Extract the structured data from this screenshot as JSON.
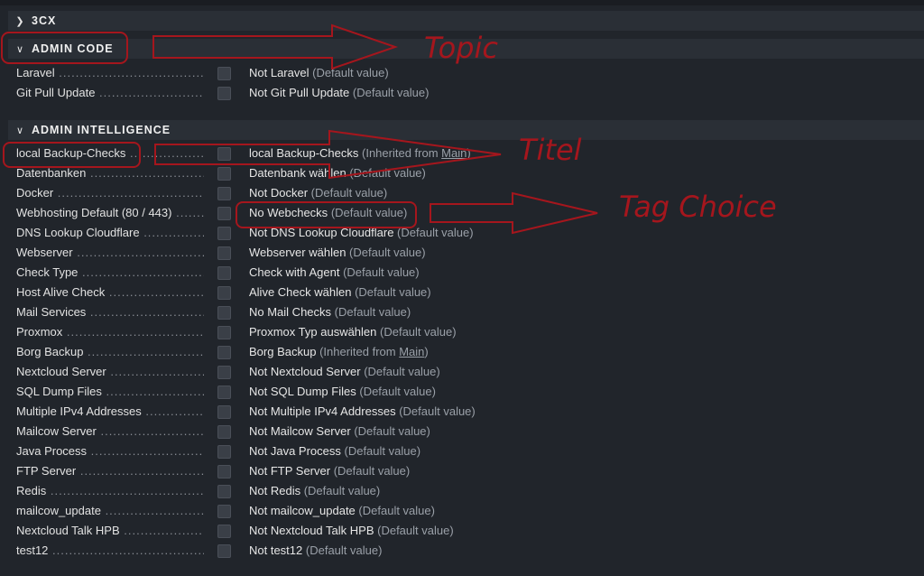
{
  "sections": {
    "cx": {
      "title": "3CX",
      "chevron": "chevron-right-icon"
    },
    "admin_code": {
      "title": "ADMIN CODE",
      "chevron": "chevron-down-icon",
      "rows": [
        {
          "label": "Laravel",
          "value": "Not Laravel",
          "note": "(Default value)"
        },
        {
          "label": "Git Pull Update",
          "value": "Not Git Pull Update",
          "note": "(Default value)"
        }
      ]
    },
    "admin_intelligence": {
      "title": "ADMIN INTELLIGENCE",
      "chevron": "chevron-down-icon",
      "rows": [
        {
          "label": "local Backup-Checks",
          "value": "local Backup-Checks",
          "note": "(Inherited from ",
          "link": "Main",
          "note_end": ")"
        },
        {
          "label": "Datenbanken",
          "value": "Datenbank wählen",
          "note": "(Default value)"
        },
        {
          "label": "Docker",
          "value": "Not Docker",
          "note": "(Default value)"
        },
        {
          "label": "Webhosting Default (80 / 443)",
          "value": "No Webchecks",
          "note": "(Default value)"
        },
        {
          "label": "DNS Lookup Cloudflare",
          "value": "Not DNS Lookup Cloudflare",
          "note": "(Default value)"
        },
        {
          "label": "Webserver",
          "value": "Webserver wählen",
          "note": "(Default value)"
        },
        {
          "label": "Check Type",
          "value": "Check with Agent",
          "note": "(Default value)"
        },
        {
          "label": "Host Alive Check",
          "value": "Alive Check wählen",
          "note": "(Default value)"
        },
        {
          "label": "Mail Services",
          "value": "No Mail Checks",
          "note": "(Default value)"
        },
        {
          "label": "Proxmox",
          "value": "Proxmox Typ auswählen",
          "note": "(Default value)"
        },
        {
          "label": "Borg Backup",
          "value": "Borg Backup",
          "note": "(Inherited from ",
          "link": "Main",
          "note_end": ")"
        },
        {
          "label": "Nextcloud Server",
          "value": "Not Nextcloud Server",
          "note": "(Default value)"
        },
        {
          "label": "SQL Dump Files",
          "value": "Not SQL Dump Files",
          "note": "(Default value)"
        },
        {
          "label": "Multiple IPv4 Addresses",
          "value": "Not Multiple IPv4 Addresses",
          "note": "(Default value)"
        },
        {
          "label": "Mailcow Server",
          "value": "Not Mailcow Server",
          "note": "(Default value)"
        },
        {
          "label": "Java Process",
          "value": "Not Java Process",
          "note": "(Default value)"
        },
        {
          "label": "FTP Server",
          "value": "Not FTP Server",
          "note": "(Default value)"
        },
        {
          "label": "Redis",
          "value": "Not Redis",
          "note": "(Default value)"
        },
        {
          "label": "mailcow_update",
          "value": "Not mailcow_update",
          "note": "(Default value)"
        },
        {
          "label": "Nextcloud Talk HPB",
          "value": "Not Nextcloud Talk HPB",
          "note": "(Default value)"
        },
        {
          "label": "test12",
          "value": "Not test12",
          "note": "(Default value)"
        }
      ]
    }
  },
  "annotations": {
    "topic": "Topic",
    "titel": "Titel",
    "tag_choice": "Tag Choice",
    "color": "#a5161d"
  },
  "colors": {
    "background": "#21252b",
    "header": "#2a2f36"
  }
}
